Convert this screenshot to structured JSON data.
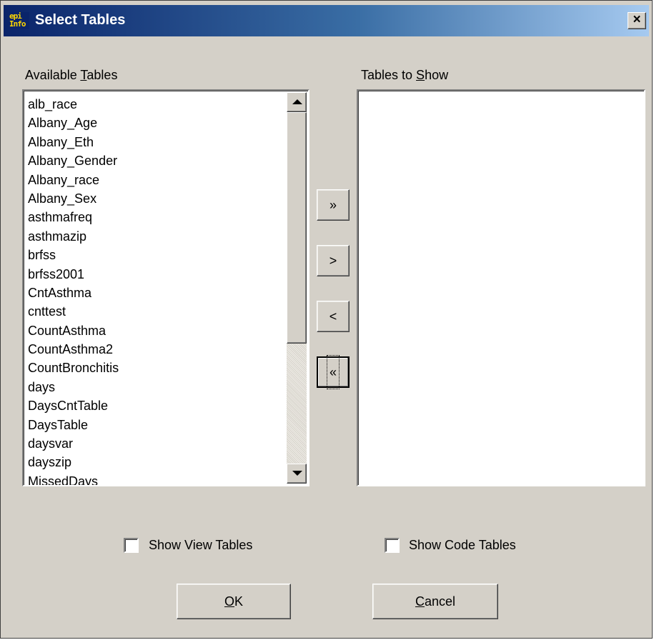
{
  "window": {
    "title": "Select Tables",
    "icon_lines": [
      "epi",
      "Info"
    ],
    "close_glyph": "×"
  },
  "available": {
    "label": "Available Tables",
    "items": [
      "alb_race",
      "Albany_Age",
      "Albany_Eth",
      "Albany_Gender",
      "Albany_race",
      "Albany_Sex",
      "asthmafreq",
      "asthmazip",
      "brfss",
      "brfss2001",
      "CntAsthma",
      "cnttest",
      "CountAsthma",
      "CountAsthma2",
      "CountBronchitis",
      "days",
      "DaysCntTable",
      "DaysTable",
      "daysvar",
      "dayszip",
      "MissedDays"
    ]
  },
  "show": {
    "label": "Tables to Show",
    "items": []
  },
  "buttons": {
    "add_all": "»",
    "add": ">",
    "remove": "<",
    "remove_all": "«",
    "ok": "OK",
    "cancel": "Cancel"
  },
  "checkboxes": {
    "view_tables": {
      "label": "Show View Tables",
      "checked": false
    },
    "code_tables": {
      "label": "Show Code Tables",
      "checked": false
    }
  }
}
